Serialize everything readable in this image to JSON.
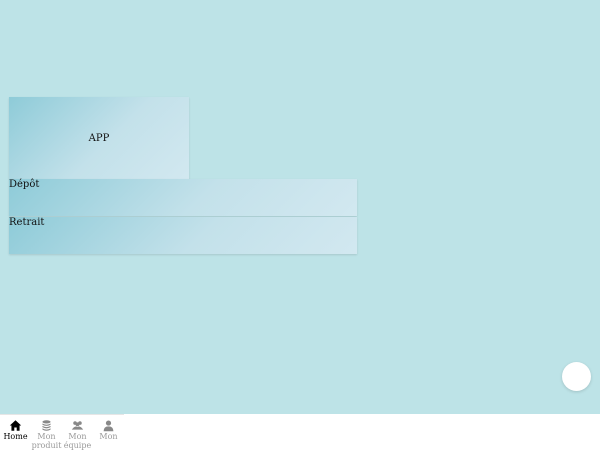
{
  "app_card": {
    "label": "APP"
  },
  "actions": [
    {
      "label": "Dépôt"
    },
    {
      "label": "Retrait"
    }
  ],
  "tabbar": {
    "items": [
      {
        "icon": "home-icon",
        "label": "Home",
        "active": true
      },
      {
        "icon": "coins-icon",
        "label": "Mon produit",
        "active": false
      },
      {
        "icon": "team-icon",
        "label": "Mon équipe",
        "active": false
      },
      {
        "icon": "user-icon",
        "label": "Mon",
        "active": false
      }
    ]
  },
  "colors": {
    "background": "#bde3e7",
    "card_gradient_start": "#8ecbd8",
    "card_gradient_end": "#d2e8f0",
    "active_tab": "#000000",
    "inactive_tab": "#999999"
  }
}
